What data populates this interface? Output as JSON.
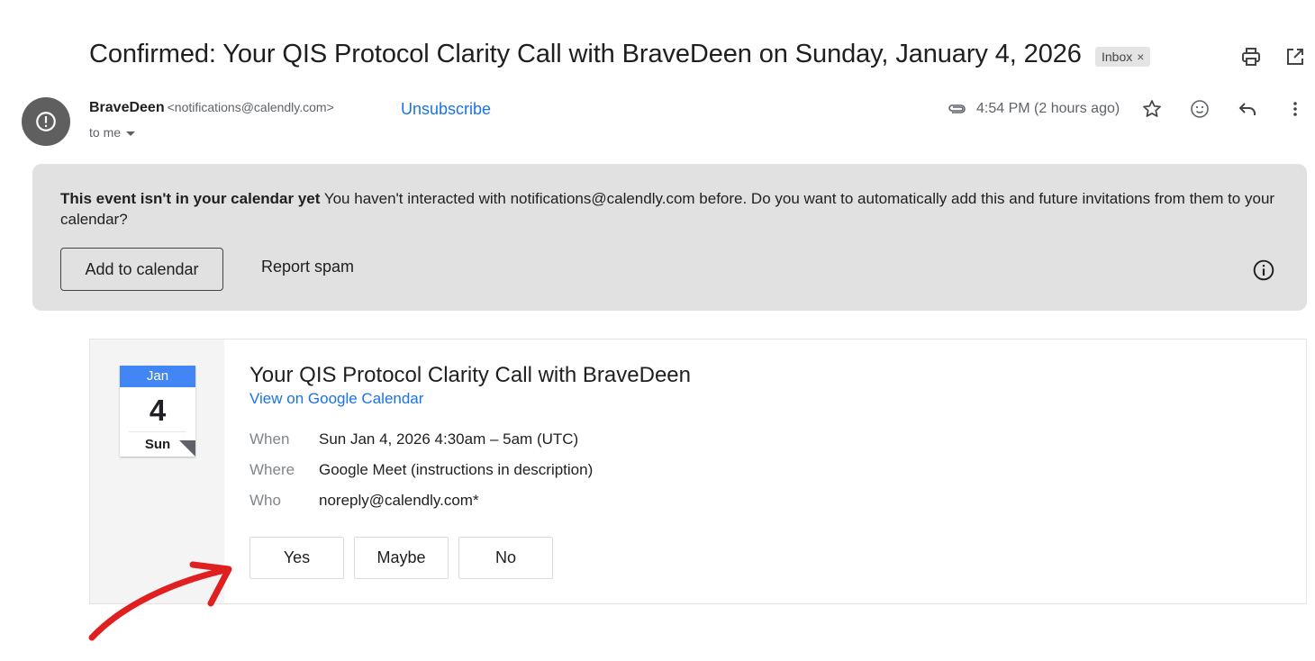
{
  "email": {
    "subject": "Confirmed: Your QIS Protocol Clarity Call with BraveDeen on Sunday, January 4, 2026",
    "label_chip": "Inbox",
    "label_chip_close": "×",
    "sender_name": "BraveDeen",
    "sender_email": "<notifications@calendly.com>",
    "unsubscribe": "Unsubscribe",
    "recipient": "to me",
    "timestamp": "4:54 PM (2 hours ago)"
  },
  "banner": {
    "heading": "This event isn't in your calendar yet",
    "message": " You haven't interacted with notifications@calendly.com before. Do you want to automatically add this and future invitations from them to your calendar?",
    "add_button": "Add to calendar",
    "spam_button": "Report spam"
  },
  "invite": {
    "month": "Jan",
    "day": "4",
    "weekday": "Sun",
    "title": "Your QIS Protocol Clarity Call with BraveDeen",
    "calendar_link": "View on Google Calendar",
    "when_label": "When",
    "when_value": "Sun Jan 4, 2026 4:30am – 5am (UTC)",
    "where_label": "Where",
    "where_value": "Google Meet (instructions in description)",
    "who_label": "Who",
    "who_value": "noreply@calendly.com*",
    "rsvp_yes": "Yes",
    "rsvp_maybe": "Maybe",
    "rsvp_no": "No"
  },
  "icons": {
    "print": "print-icon",
    "open_new_window": "open-in-new-icon",
    "attachment": "attachment-icon",
    "star": "star-icon",
    "emoji": "emoji-icon",
    "reply": "reply-icon",
    "more": "more-vert-icon",
    "info": "info-icon",
    "alert_avatar": "alert-icon"
  },
  "colors": {
    "link": "#1a73e8",
    "calendar_header": "#4285f4",
    "banner_bg": "#e1e1e1",
    "annotation_arrow": "#e02020"
  }
}
